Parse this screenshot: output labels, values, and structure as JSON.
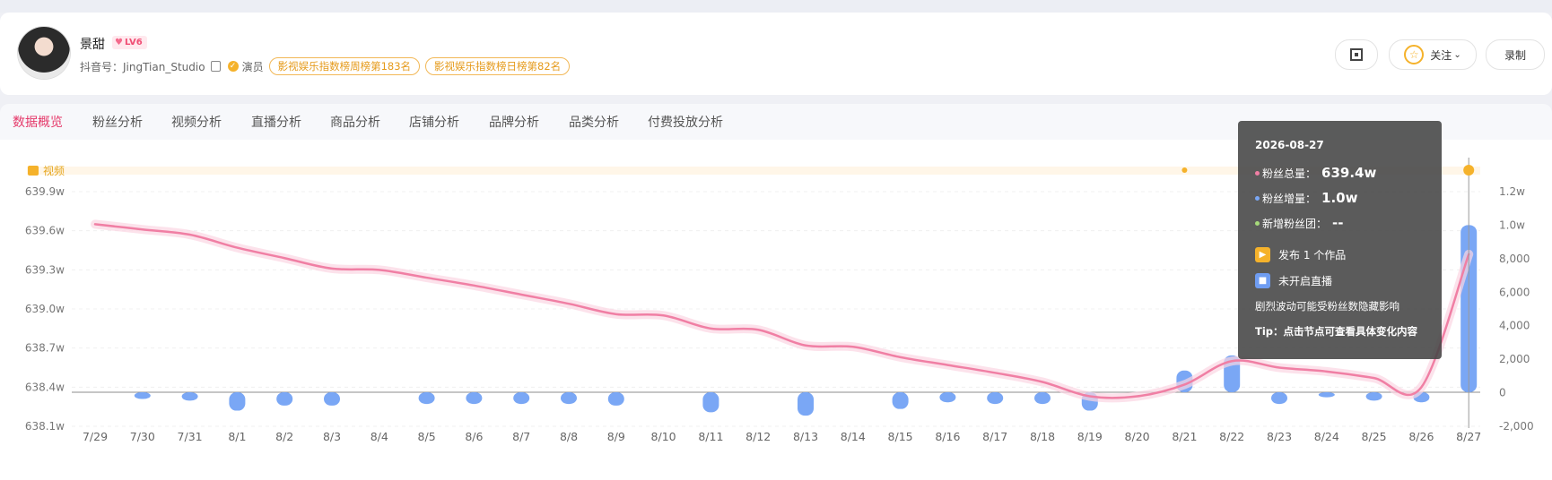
{
  "profile": {
    "name": "景甜",
    "level": "LV6",
    "account_label": "抖音号：JingTian_Studio",
    "role": "演员",
    "ranks": [
      "影视娱乐指数榜周榜第183名",
      "影视娱乐指数榜日榜第82名"
    ]
  },
  "header_buttons": {
    "follow": "关注",
    "record": "录制"
  },
  "tabs": [
    "数据概览",
    "粉丝分析",
    "视频分析",
    "直播分析",
    "商品分析",
    "店铺分析",
    "品牌分析",
    "品类分析",
    "付费投放分析"
  ],
  "legend": {
    "video": "视频"
  },
  "tooltip": {
    "date": "2026-08-27",
    "total_label": "粉丝总量：",
    "total_value": "639.4w",
    "delta_label": "粉丝增量：",
    "delta_value": "1.0w",
    "club_label": "新增粉丝团：",
    "club_value": "--",
    "event1": "发布 1 个作品",
    "event2": "未开启直播",
    "note": "剧烈波动可能受粉丝数隐藏影响",
    "tip": "Tip：点击节点可查看具体变化内容"
  },
  "colors": {
    "accent": "#e5396a",
    "line": "#f07fa4",
    "bar": "#7aa7f5",
    "video": "#f5b22b"
  },
  "chart_data": {
    "type": "line",
    "categories": [
      "7/29",
      "7/30",
      "7/31",
      "8/1",
      "8/2",
      "8/3",
      "8/4",
      "8/5",
      "8/6",
      "8/7",
      "8/8",
      "8/9",
      "8/10",
      "8/11",
      "8/12",
      "8/13",
      "8/14",
      "8/15",
      "8/16",
      "8/17",
      "8/18",
      "8/19",
      "8/20",
      "8/21",
      "8/22",
      "8/23",
      "8/24",
      "8/25",
      "8/26",
      "8/27"
    ],
    "y_left": {
      "ticks": [
        "639.9w",
        "639.6w",
        "639.3w",
        "639.0w",
        "638.7w",
        "638.4w",
        "638.1w"
      ],
      "range": [
        638.1,
        639.9
      ]
    },
    "y_right": {
      "ticks": [
        "1.2w",
        "1.0w",
        "8,000",
        "6,000",
        "4,000",
        "2,000",
        "0",
        "-2,000"
      ],
      "range": [
        -2000,
        12000
      ]
    },
    "series": [
      {
        "name": "粉丝总量",
        "unit": "w",
        "type": "line",
        "values": [
          639.65,
          639.61,
          639.57,
          639.47,
          639.39,
          639.31,
          639.3,
          639.24,
          639.18,
          639.11,
          639.04,
          638.96,
          638.95,
          638.85,
          638.84,
          638.72,
          638.71,
          638.63,
          638.57,
          638.51,
          638.44,
          638.33,
          638.33,
          638.42,
          638.6,
          638.55,
          638.52,
          638.47,
          638.4,
          639.42
        ]
      },
      {
        "name": "粉丝增量",
        "type": "bar",
        "values": [
          -400,
          -500,
          -1100,
          -800,
          -800,
          null,
          -700,
          -700,
          -700,
          -700,
          -800,
          null,
          -1200,
          null,
          -1400,
          null,
          -1000,
          -600,
          -700,
          -700,
          -1100,
          null,
          1300,
          2200,
          -700,
          -300,
          -500,
          -600,
          10000
        ]
      }
    ],
    "video_markers": [
      "8/21",
      "8/27"
    ]
  }
}
